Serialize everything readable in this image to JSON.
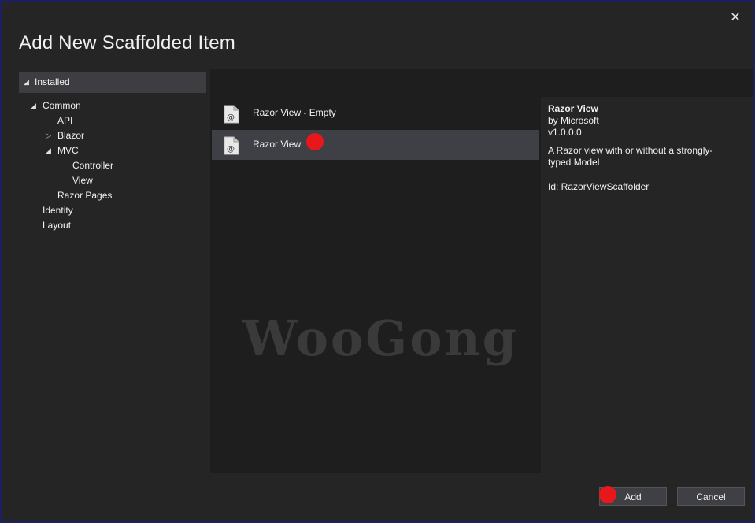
{
  "dialog": {
    "title": "Add New Scaffolded Item",
    "close_glyph": "✕"
  },
  "tree": {
    "root": {
      "label": "Installed",
      "expander": "◢"
    },
    "items": [
      {
        "label": "Common",
        "expander": "◢"
      },
      {
        "label": "API"
      },
      {
        "label": "Blazor",
        "expander": "▷"
      },
      {
        "label": "MVC",
        "expander": "◢"
      },
      {
        "label": "Controller"
      },
      {
        "label": "View"
      },
      {
        "label": "Razor Pages"
      },
      {
        "label": "Identity"
      },
      {
        "label": "Layout"
      }
    ]
  },
  "templates": {
    "items": [
      {
        "label": "Razor View - Empty",
        "icon": "razor-file-icon",
        "selected": false
      },
      {
        "label": "Razor View",
        "icon": "razor-file-icon",
        "selected": true
      }
    ],
    "icon_glyph": "@"
  },
  "watermark": "WooGong",
  "details": {
    "name": "Razor View",
    "by": "by Microsoft",
    "version": "v1.0.0.0",
    "description": "A Razor view with or without a strongly-typed Model",
    "id": "Id: RazorViewScaffolder"
  },
  "footer": {
    "add_label": "Add",
    "cancel_label": "Cancel"
  },
  "colors": {
    "marker": "#e8171b",
    "selected_bg": "#3f3f46",
    "dialog_bg": "#252526"
  }
}
